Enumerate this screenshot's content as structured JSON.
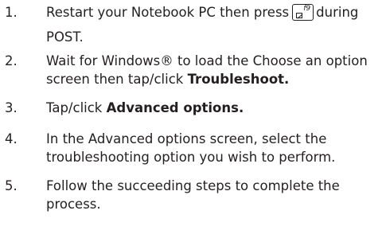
{
  "steps": [
    {
      "num": "1.",
      "before_key": "Restart your Notebook PC then press",
      "key_label": "f9",
      "after_key": "during",
      "line2": "POST."
    },
    {
      "num": "2.",
      "line1": "Wait for Windows® to load the Choose an option",
      "line2_prefix": "screen then tap/click ",
      "line2_bold": "Troubleshoot."
    },
    {
      "num": "3.",
      "prefix": "Tap/click ",
      "bold": "Advanced options."
    },
    {
      "num": "4.",
      "line1": "In the Advanced options screen, select the",
      "line2": "troubleshooting option you wish to perform."
    },
    {
      "num": "5.",
      "line1": "Follow the succeeding steps to complete the",
      "line2": "process."
    }
  ]
}
